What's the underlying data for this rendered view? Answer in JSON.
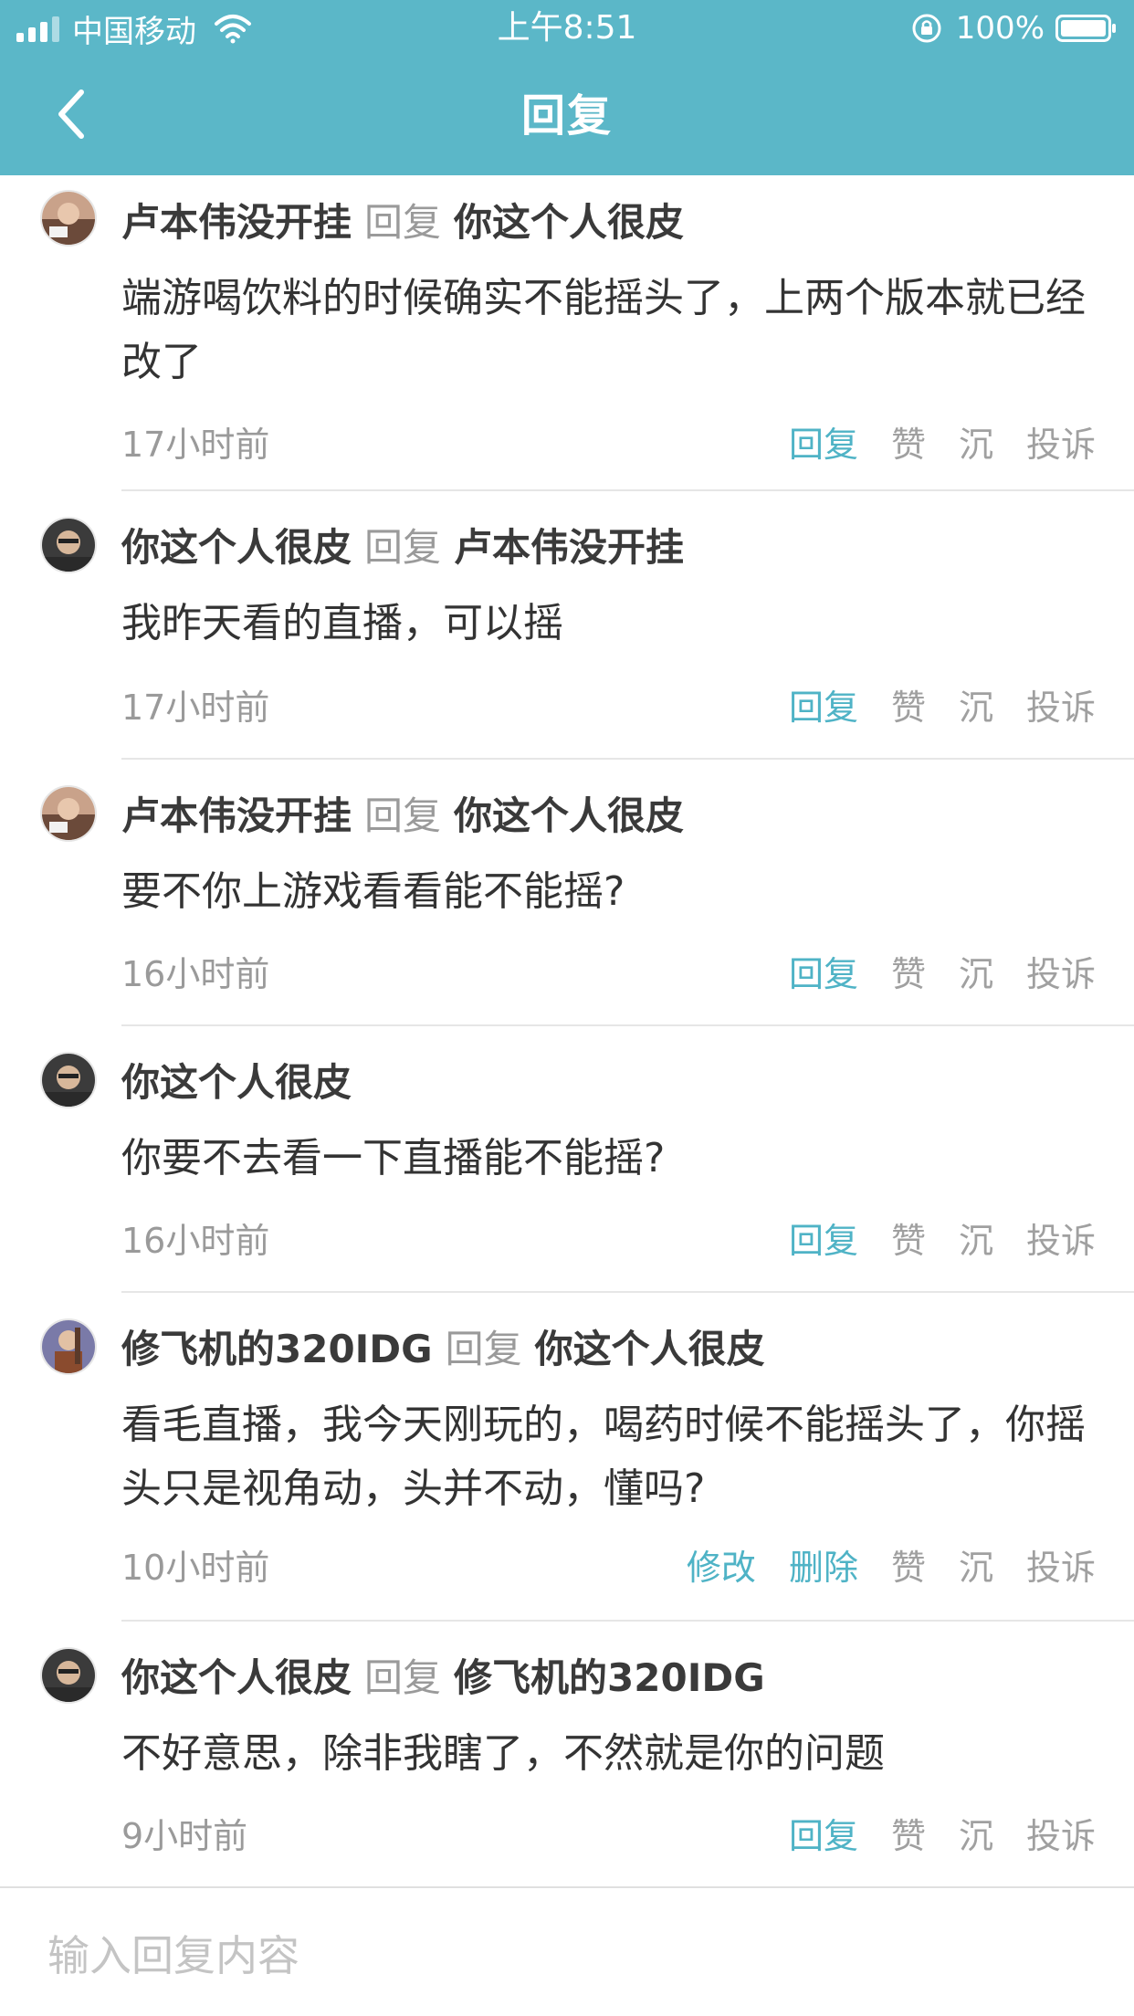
{
  "status_bar": {
    "carrier": "中国移动",
    "time": "上午8:51",
    "battery": "100%"
  },
  "header": {
    "title": "回复",
    "back_icon": "chevron-left-icon",
    "color": "#5bb7c8"
  },
  "comments": [
    {
      "author": "卢本伟没开挂",
      "reply_word": "回复",
      "target": "你这个人很皮",
      "avatar": "avatar-photo",
      "body": "端游喝饮料的时候确实不能摇头了，上两个版本就已经改了",
      "time": "17小时前",
      "actions": [
        "回复",
        "赞",
        "沉",
        "投诉"
      ]
    },
    {
      "author": "你这个人很皮",
      "reply_word": "回复",
      "target": "卢本伟没开挂",
      "avatar": "avatar-photo",
      "body": "我昨天看的直播，可以摇",
      "time": "17小时前",
      "actions": [
        "回复",
        "赞",
        "沉",
        "投诉"
      ]
    },
    {
      "author": "卢本伟没开挂",
      "reply_word": "回复",
      "target": "你这个人很皮",
      "avatar": "avatar-photo",
      "body": "要不你上游戏看看能不能摇?",
      "time": "16小时前",
      "actions": [
        "回复",
        "赞",
        "沉",
        "投诉"
      ]
    },
    {
      "author": "你这个人很皮",
      "reply_word": "",
      "target": "",
      "avatar": "avatar-photo",
      "body": "你要不去看一下直播能不能摇?",
      "time": "16小时前",
      "actions": [
        "回复",
        "赞",
        "沉",
        "投诉"
      ]
    },
    {
      "author": "修飞机的320IDG",
      "reply_word": "回复",
      "target": "你这个人很皮",
      "avatar": "avatar-photo",
      "body": "看毛直播，我今天刚玩的，喝药时候不能摇头了，你摇头只是视角动，头并不动，懂吗?",
      "time": "10小时前",
      "actions": [
        "修改",
        "删除",
        "赞",
        "沉",
        "投诉"
      ]
    },
    {
      "author": "你这个人很皮",
      "reply_word": "回复",
      "target": "修飞机的320IDG",
      "avatar": "avatar-photo",
      "body": "不好意思，除非我瞎了，不然就是你的问题",
      "time": "9小时前",
      "actions": [
        "回复",
        "赞",
        "沉",
        "投诉"
      ]
    }
  ],
  "input": {
    "placeholder": "输入回复内容",
    "value": ""
  },
  "colors": {
    "accent": "#4fb3c6",
    "muted": "#a0a0a0"
  }
}
